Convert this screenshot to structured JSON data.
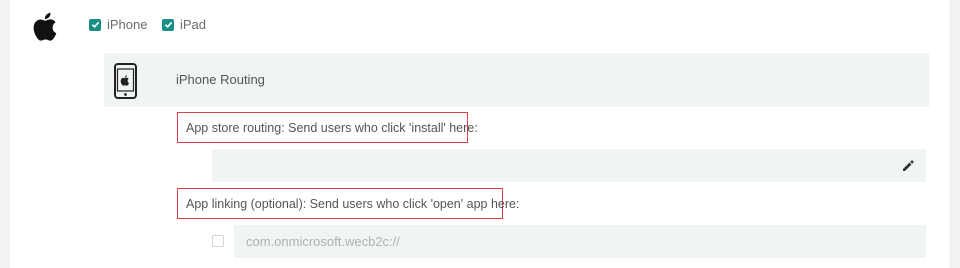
{
  "platforms": {
    "logo_icon": "apple-icon",
    "iphone": {
      "label": "iPhone",
      "checked": true
    },
    "ipad": {
      "label": "iPad",
      "checked": true
    }
  },
  "routing": {
    "title": "iPhone Routing",
    "icon": "smartphone-icon",
    "app_store_label": "App store routing: Send users who click 'install' here:",
    "app_store_value": "",
    "app_linking_label": "App linking (optional): Send users who click 'open' app here:",
    "app_linking_placeholder": "com.onmicrosoft.wecb2c://",
    "app_linking_checked": false
  },
  "colors": {
    "accent": "#1a8f86",
    "highlight_border": "#d64545",
    "field_bg": "#f1f4f4"
  }
}
